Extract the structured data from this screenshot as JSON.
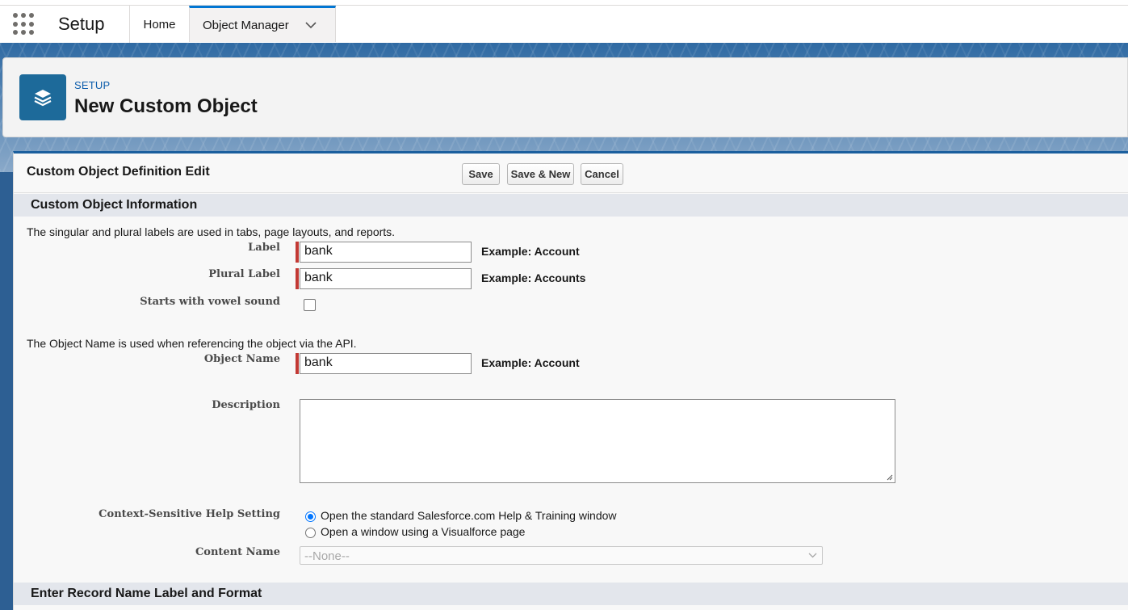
{
  "topnav": {
    "app_name": "Setup",
    "tabs": [
      {
        "label": "Home"
      },
      {
        "label": "Object Manager"
      }
    ]
  },
  "header": {
    "breadcrumb": "SETUP",
    "title": "New Custom Object"
  },
  "form": {
    "title": "Custom Object Definition Edit",
    "buttons": {
      "save": "Save",
      "save_new": "Save & New",
      "cancel": "Cancel"
    },
    "section_info": "Custom Object Information",
    "labels_help": "The singular and plural labels are used in tabs, page layouts, and reports.",
    "label": {
      "label": "Label",
      "value": "bank",
      "example": "Example:  Account"
    },
    "plural_label": {
      "label": "Plural Label",
      "value": "bank",
      "example": "Example:  Accounts"
    },
    "vowel": {
      "label": "Starts with vowel sound",
      "checked": false
    },
    "object_name_help": "The Object Name is used when referencing the object via the API.",
    "object_name": {
      "label": "Object Name",
      "value": "bank",
      "example": "Example:  Account"
    },
    "description": {
      "label": "Description",
      "value": ""
    },
    "help_setting": {
      "label": "Context-Sensitive Help Setting",
      "options": [
        {
          "label": "Open the standard Salesforce.com Help & Training window",
          "selected": true
        },
        {
          "label": "Open a window using a Visualforce page",
          "selected": false
        }
      ]
    },
    "content_name": {
      "label": "Content Name",
      "value": "--None--"
    },
    "section_record_name": "Enter Record Name Label and Format"
  },
  "colors": {
    "accent": "#0176d3",
    "object_icon": "#1d6a9a",
    "required": "#c23934"
  }
}
